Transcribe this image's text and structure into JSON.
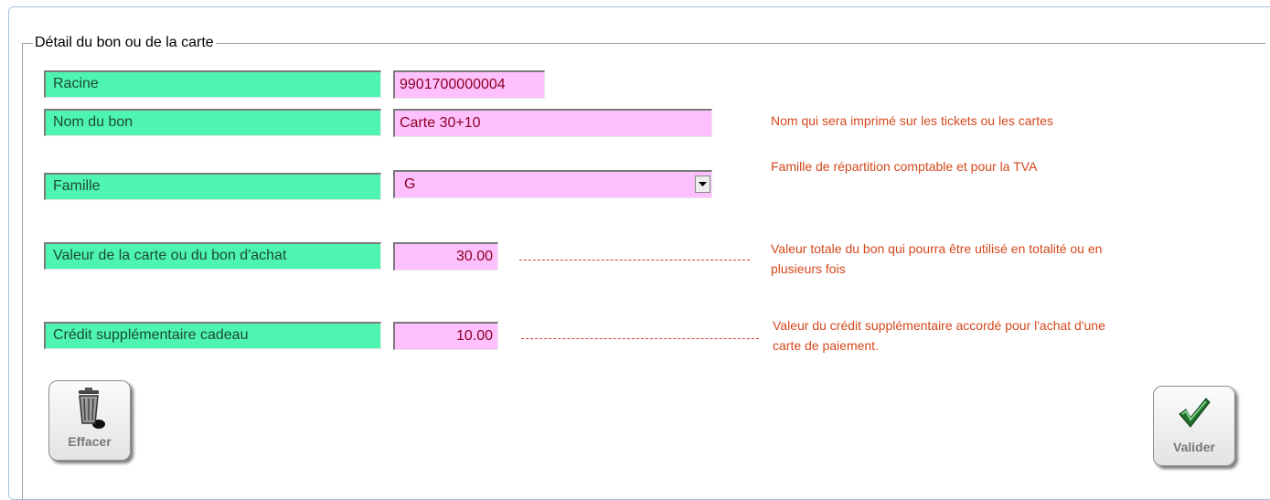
{
  "group": {
    "title": "Détail du bon ou de la carte"
  },
  "fields": {
    "racine": {
      "label": "Racine",
      "value": "9901700000004"
    },
    "nom": {
      "label": "Nom du bon",
      "value": "Carte 30+10",
      "hint": "Nom qui sera imprimé sur les tickets ou les cartes"
    },
    "famille": {
      "label": "Famille",
      "value": "G",
      "hint": "Famille de répartition comptable et pour la TVA"
    },
    "valeur": {
      "label": "Valeur de la carte ou du bon d'achat",
      "value": "30.00",
      "hint_line1": "Valeur totale du bon qui pourra être utilisé en totalité ou en",
      "hint_line2": "plusieurs fois"
    },
    "credit": {
      "label": "Crédit supplémentaire cadeau",
      "value": "10.00",
      "hint_line1": "Valeur du crédit supplémentaire accordé pour l'achat d'une",
      "hint_line2": "carte de paiement."
    }
  },
  "buttons": {
    "effacer": {
      "label": "Effacer",
      "icon": "trash-icon"
    },
    "valider": {
      "label": "Valider",
      "icon": "checkmark-icon"
    }
  },
  "colors": {
    "label_bg": "#4ef5b0",
    "field_bg": "#ffc0ff",
    "hint_text": "#d4481c",
    "field_text": "#8b0023"
  }
}
